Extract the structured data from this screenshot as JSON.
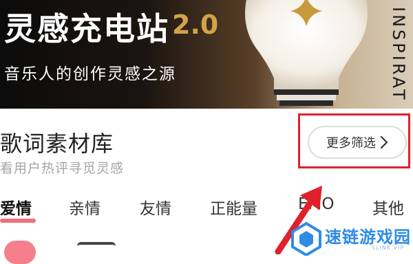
{
  "banner": {
    "title": "灵感充电站",
    "version": "2.0",
    "subtitle": "音乐人的创作灵感之源",
    "side_text": "INSPIRAT"
  },
  "section": {
    "title": "歌词素材库",
    "subtitle": "看用户热评寻觅灵感",
    "filter_button": "更多筛选",
    "filter_icon": "chevron-right-icon"
  },
  "tabs": {
    "items": [
      {
        "label": "爱情",
        "active": true
      },
      {
        "label": "亲情",
        "active": false
      },
      {
        "label": "友情",
        "active": false
      },
      {
        "label": "正能量",
        "active": false
      },
      {
        "label": "EMO",
        "active": false
      },
      {
        "label": "其他",
        "active": false
      }
    ]
  },
  "watermark": {
    "text": "速链游戏园",
    "domain": "SLINK.VIP"
  },
  "colors": {
    "accent_pink": "#f06f79",
    "highlight_red": "#e0202a",
    "banner_gold": "#d2a449",
    "watermark_blue": "#2f8be6"
  }
}
